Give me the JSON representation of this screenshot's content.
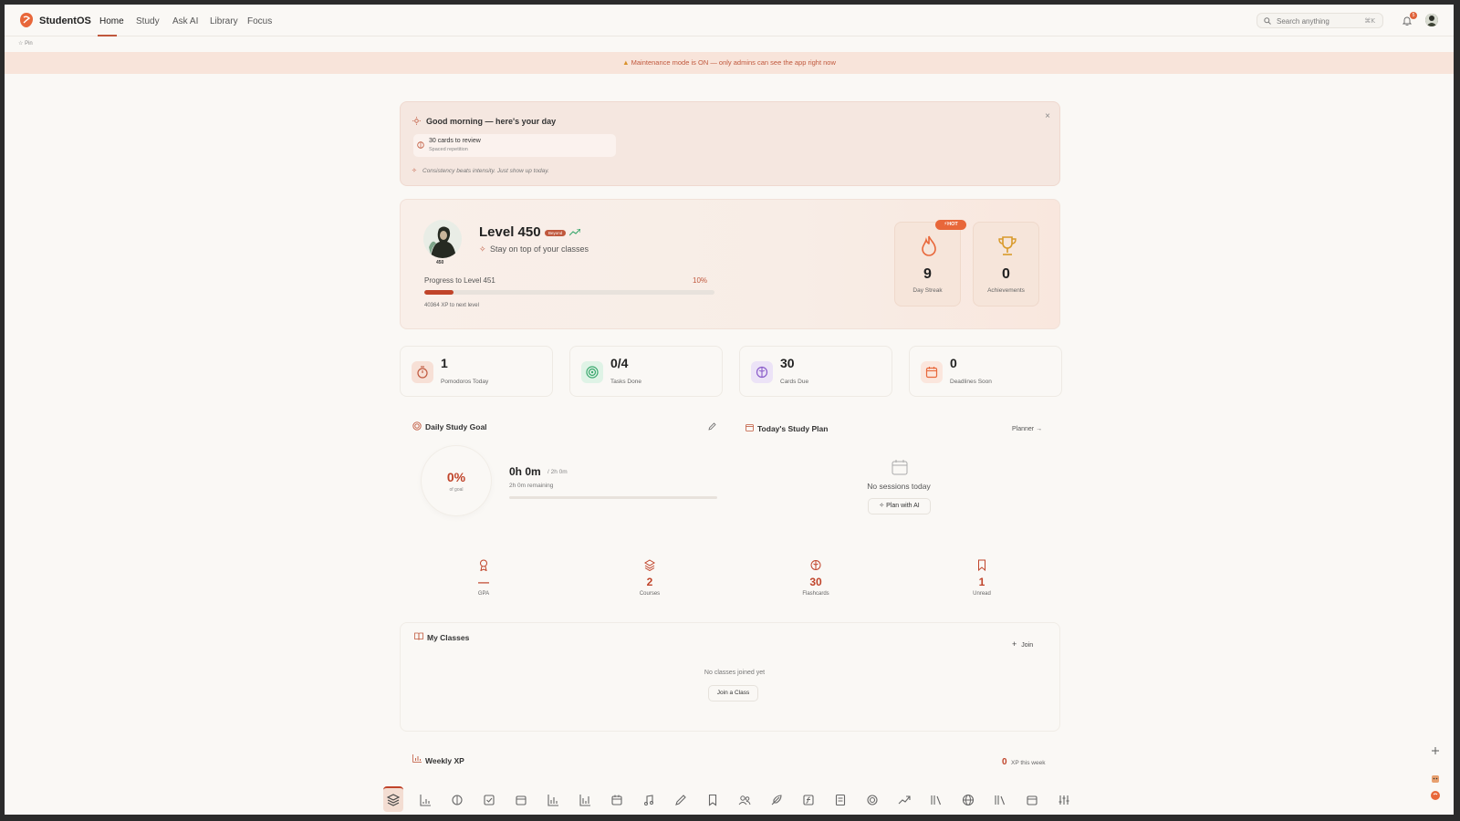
{
  "nav": {
    "brand": "StudentOS",
    "links": [
      "Home",
      "Study",
      "Ask AI",
      "Library",
      "Focus"
    ],
    "search_placeholder": "Search anything",
    "search_kbd": "⌘K",
    "notif_count": "5"
  },
  "pin": {
    "label": "Pin"
  },
  "banner": {
    "text": "Maintenance mode is ON — only admins can see the app right now"
  },
  "greeting": {
    "title": "Good morning — here's your day",
    "close": "×",
    "review_title": "30 cards to review",
    "review_sub": "Spaced repetition",
    "quote": "Consistency beats intensity. Just show up today."
  },
  "level": {
    "title": "Level 450",
    "badge": "Beyond",
    "avatar_level": "450",
    "subtitle": "Stay on top of your classes",
    "progress_label": "Progress to Level 451",
    "progress_pct": "10%",
    "progress_value": 0.1,
    "xp_next": "40364 XP to next level",
    "hot_badge": "HOT",
    "streak_value": "9",
    "streak_label": "Day Streak",
    "achievements_value": "0",
    "achievements_label": "Achievements"
  },
  "stats": [
    {
      "value": "1",
      "label": "Pomodoros Today"
    },
    {
      "value": "0/4",
      "label": "Tasks Done"
    },
    {
      "value": "30",
      "label": "Cards Due"
    },
    {
      "value": "0",
      "label": "Deadlines Soon"
    }
  ],
  "goal": {
    "title": "Daily Study Goal",
    "pct": "0%",
    "of_goal": "of goal",
    "time": "0h 0m",
    "total": "/ 2h 0m",
    "remaining": "2h 0m remaining"
  },
  "plan": {
    "title": "Today's Study Plan",
    "planner_link": "Planner →",
    "empty": "No sessions today",
    "plan_ai": "Plan with AI"
  },
  "kpis": [
    {
      "value": "—",
      "label": "GPA"
    },
    {
      "value": "2",
      "label": "Courses"
    },
    {
      "value": "30",
      "label": "Flashcards"
    },
    {
      "value": "1",
      "label": "Unread"
    }
  ],
  "classes": {
    "title": "My Classes",
    "join": "Join",
    "empty": "No classes joined yet",
    "join_class": "Join a Class"
  },
  "weekly": {
    "title": "Weekly XP",
    "value": "0",
    "suffix": "XP this week"
  },
  "colors": {
    "accent": "#c0442a",
    "accent_light": "#f8e4da",
    "background": "#faf8f5"
  }
}
